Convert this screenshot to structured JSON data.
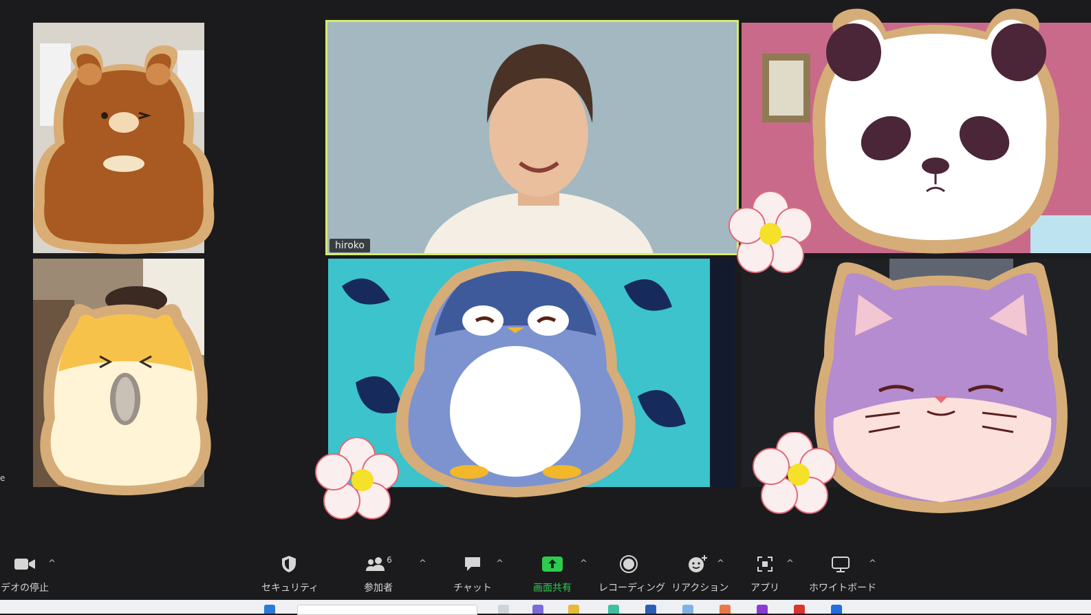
{
  "meeting": {
    "participants": [
      {
        "name": "",
        "sticker": "bear"
      },
      {
        "name": "hiroko",
        "sticker": "none",
        "active_speaker": true
      },
      {
        "name": "",
        "sticker": "panda"
      },
      {
        "name": "",
        "sticker": "hamster"
      },
      {
        "name": "",
        "sticker": "penguin"
      },
      {
        "name": "",
        "sticker": "cat"
      }
    ],
    "edge_text": "e"
  },
  "toolbar": {
    "video": {
      "label": "デオの停止",
      "icon": "video-camera-icon"
    },
    "security": {
      "label": "セキュリティ",
      "icon": "shield-icon"
    },
    "participants": {
      "label": "参加者",
      "count": "6",
      "icon": "people-icon"
    },
    "chat": {
      "label": "チャット",
      "icon": "chat-bubble-icon"
    },
    "share": {
      "label": "画面共有",
      "icon": "share-screen-icon",
      "color": "#2dcc4d"
    },
    "record": {
      "label": "レコーディング",
      "icon": "record-icon"
    },
    "reactions": {
      "label": "リアクション",
      "icon": "smile-plus-icon"
    },
    "apps": {
      "label": "アプリ",
      "icon": "apps-icon"
    },
    "whiteboard": {
      "label": "ホワイトボード",
      "icon": "whiteboard-icon"
    }
  },
  "colors": {
    "active_border": "#d6ec6a",
    "background": "#1b1b1d",
    "share_green": "#2dcc4d"
  }
}
